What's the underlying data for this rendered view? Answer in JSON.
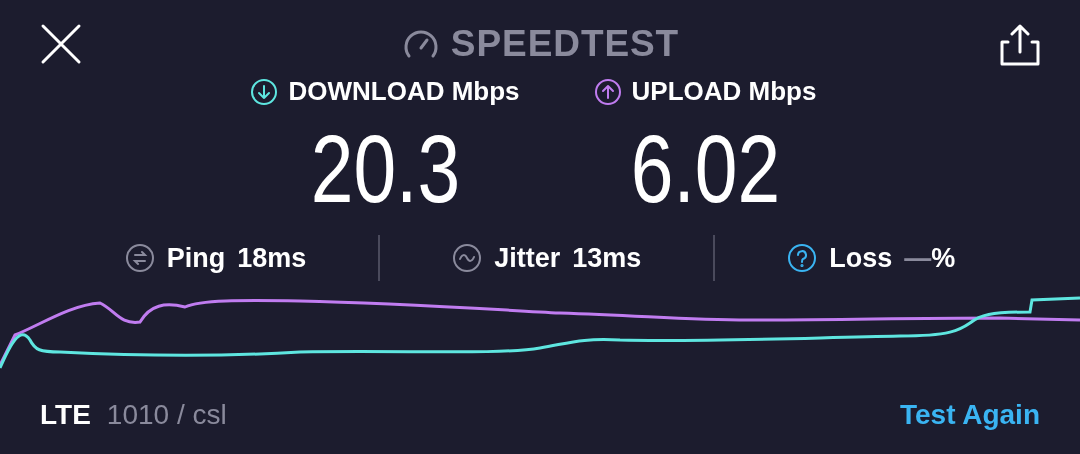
{
  "header": {
    "title": "SPEEDTEST"
  },
  "results": [
    {
      "kind": "download",
      "label": "DOWNLOAD Mbps",
      "value": "20.3",
      "color": "#5ee6e0"
    },
    {
      "kind": "upload",
      "label": "UPLOAD Mbps",
      "value": "6.02",
      "color": "#c07cf0"
    }
  ],
  "stats": [
    {
      "kind": "ping",
      "label": "Ping",
      "value": "18ms"
    },
    {
      "kind": "jitter",
      "label": "Jitter",
      "value": "13ms"
    },
    {
      "kind": "loss",
      "label": "Loss",
      "value": "—",
      "unit": "%"
    }
  ],
  "footer": {
    "network": "LTE",
    "carrier": "1010 / csl",
    "action": "Test Again"
  }
}
